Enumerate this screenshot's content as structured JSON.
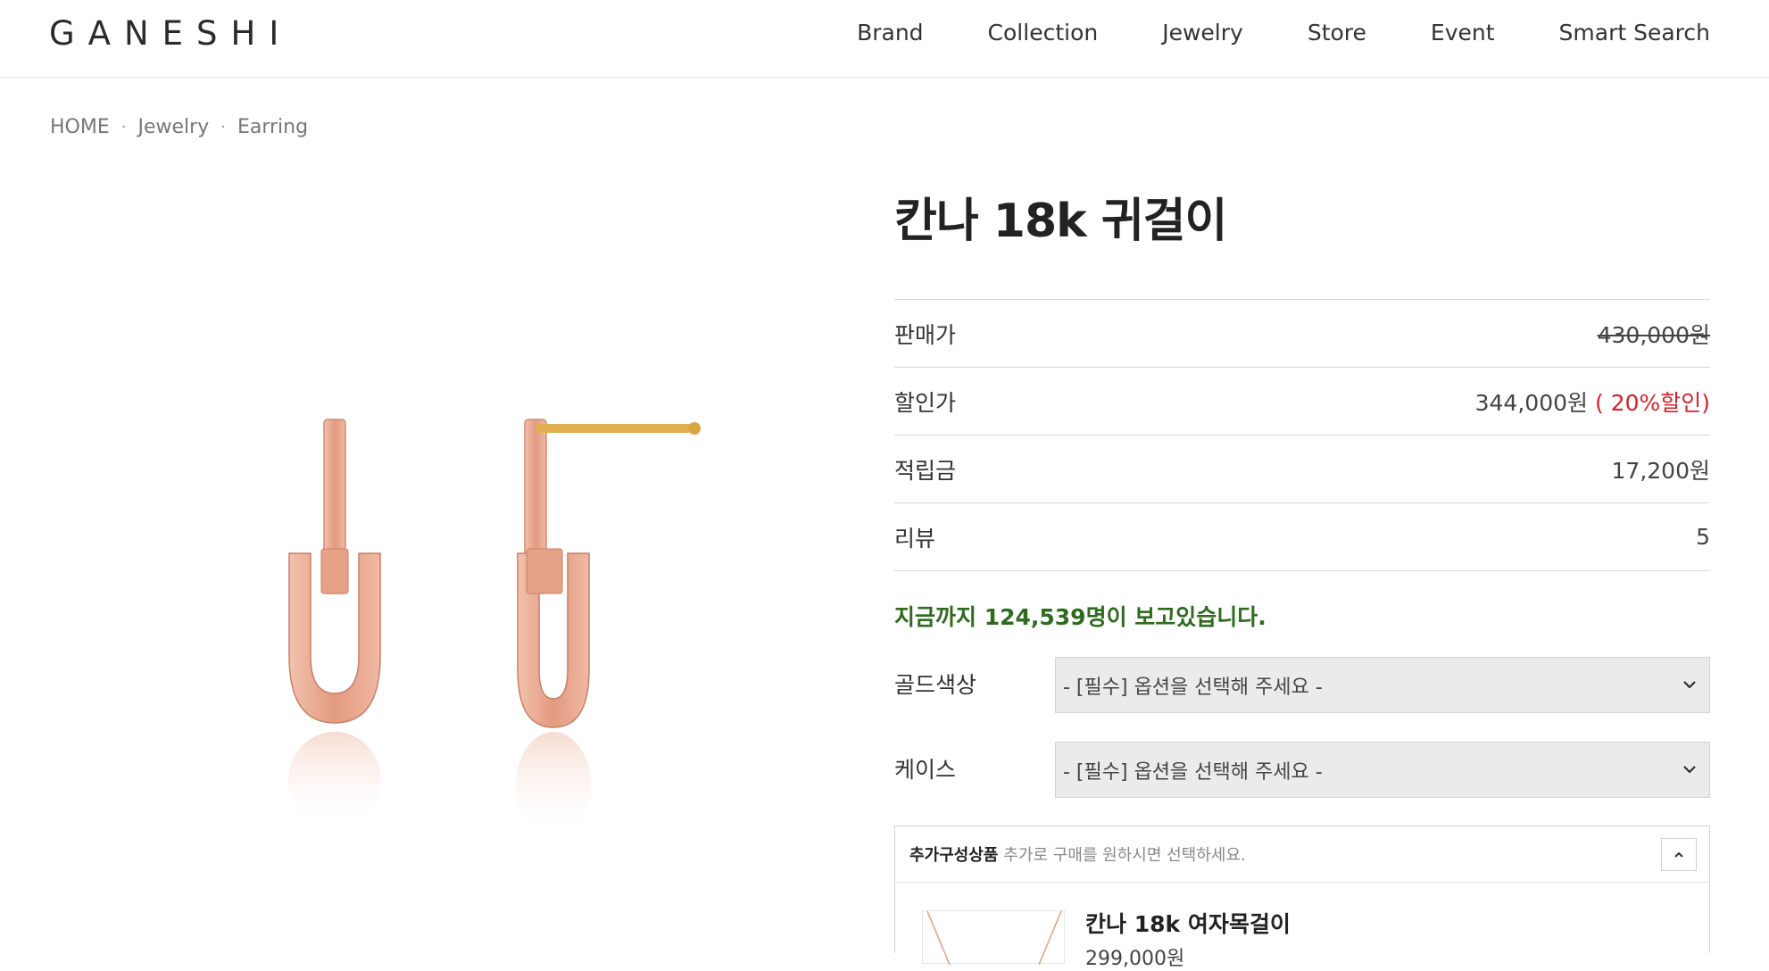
{
  "brand": {
    "logo": "GANESHI"
  },
  "nav": {
    "items": [
      "Brand",
      "Collection",
      "Jewelry",
      "Store",
      "Event",
      "Smart Search"
    ]
  },
  "breadcrumb": [
    "HOME",
    "Jewelry",
    "Earring"
  ],
  "product": {
    "title": "칸나 18k 귀걸이",
    "rows": [
      {
        "label": "판매가",
        "value": "430,000원"
      },
      {
        "label": "할인가",
        "value": "344,000원",
        "discount": "( 20%할인)"
      },
      {
        "label": "적립금",
        "value": "17,200원"
      },
      {
        "label": "리뷰",
        "value": "5"
      }
    ],
    "viewers": "지금까지 124,539명이 보고있습니다.",
    "options": [
      {
        "label": "골드색상",
        "placeholder": "- [필수] 옵션을 선택해 주세요 -"
      },
      {
        "label": "케이스",
        "placeholder": "- [필수] 옵션을 선택해 주세요 -"
      }
    ],
    "addon": {
      "title": "추가구성상품",
      "description": "추가로 구매를 원하시면 선택하세요.",
      "item_name": "칸나 18k 여자목걸이",
      "item_price": "299,000원"
    }
  },
  "colors": {
    "accent_red": "#d2232a",
    "viewer_green": "#2f6b1f",
    "rose_gold": "#e8a88f"
  }
}
